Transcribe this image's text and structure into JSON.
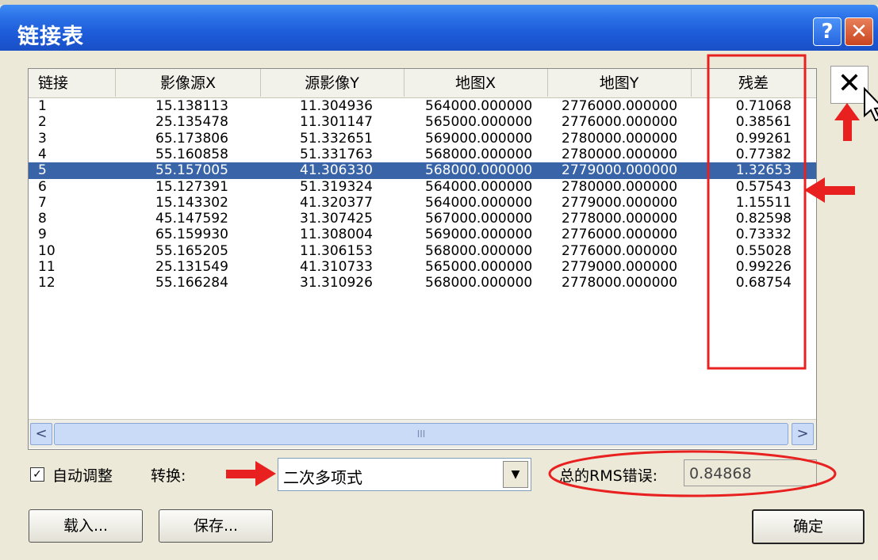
{
  "window": {
    "title": "链接表",
    "help_glyph": "?",
    "close_glyph": "✕"
  },
  "table": {
    "columns": [
      "链接",
      "影像源X",
      "源影像Y",
      "地图X",
      "地图Y",
      "残差"
    ],
    "rows": [
      [
        "1",
        "15.138113",
        "11.304936",
        "564000.000000",
        "2776000.000000",
        "0.71068"
      ],
      [
        "2",
        "25.135478",
        "11.301147",
        "565000.000000",
        "2776000.000000",
        "0.38561"
      ],
      [
        "3",
        "65.173806",
        "51.332651",
        "569000.000000",
        "2780000.000000",
        "0.99261"
      ],
      [
        "4",
        "55.160858",
        "51.331763",
        "568000.000000",
        "2780000.000000",
        "0.77382"
      ],
      [
        "5",
        "55.157005",
        "41.306330",
        "568000.000000",
        "2779000.000000",
        "1.32653"
      ],
      [
        "6",
        "15.127391",
        "51.319324",
        "564000.000000",
        "2780000.000000",
        "0.57543"
      ],
      [
        "7",
        "15.143302",
        "41.320377",
        "564000.000000",
        "2779000.000000",
        "1.15511"
      ],
      [
        "8",
        "45.147592",
        "31.307425",
        "567000.000000",
        "2778000.000000",
        "0.82598"
      ],
      [
        "9",
        "65.159930",
        "11.308004",
        "569000.000000",
        "2776000.000000",
        "0.73332"
      ],
      [
        "10",
        "55.165205",
        "11.306153",
        "568000.000000",
        "2776000.000000",
        "0.55028"
      ],
      [
        "11",
        "25.131549",
        "41.310733",
        "565000.000000",
        "2779000.000000",
        "0.99226"
      ],
      [
        "12",
        "55.166284",
        "31.310926",
        "568000.000000",
        "2778000.000000",
        "0.68754"
      ]
    ],
    "selected_row": 5,
    "scroll_left": "<",
    "scroll_right": ">",
    "scroll_grip": "III"
  },
  "delete_link_glyph": "✕",
  "controls": {
    "auto_adjust_label": "自动调整",
    "auto_adjust_checked": true,
    "transform_label": "转换:",
    "transform_value": "二次多项式",
    "rms_label": "总的RMS错误:",
    "rms_value": "0.84868"
  },
  "buttons": {
    "load": "载入...",
    "save": "保存...",
    "ok": "确定"
  },
  "colors": {
    "title_bar": "#1c5ad8",
    "selection": "#3a64a8",
    "annotation": "#e8201f"
  }
}
